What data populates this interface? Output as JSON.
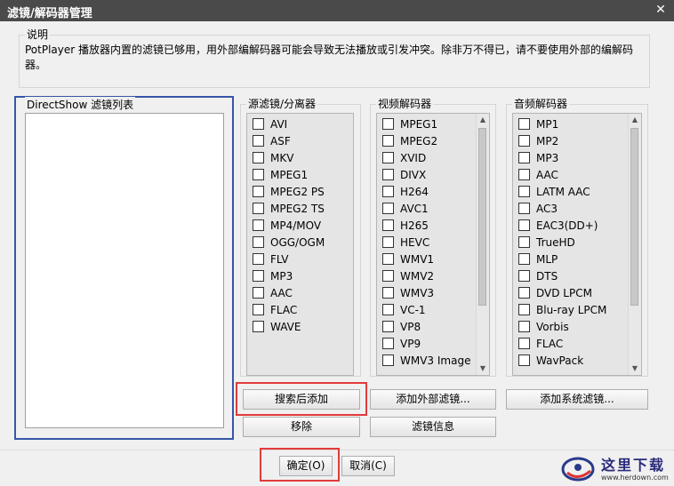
{
  "window": {
    "title": "滤镜/解码器管理",
    "close_glyph": "✕"
  },
  "description": {
    "label": "说明",
    "text": "PotPlayer 播放器内置的滤镜已够用，用外部编解码器可能会导致无法播放或引发冲突。除非万不得已，请不要使用外部的编解码器。"
  },
  "directshow": {
    "label": "DirectShow 滤镜列表"
  },
  "source_filters": {
    "label": "源滤镜/分离器",
    "items": [
      "AVI",
      "ASF",
      "MKV",
      "MPEG1",
      "MPEG2 PS",
      "MPEG2 TS",
      "MP4/MOV",
      "OGG/OGM",
      "FLV",
      "MP3",
      "AAC",
      "FLAC",
      "WAVE"
    ]
  },
  "video_decoders": {
    "label": "视频解码器",
    "items": [
      "MPEG1",
      "MPEG2",
      "XVID",
      "DIVX",
      "H264",
      "AVC1",
      "H265",
      "HEVC",
      "WMV1",
      "WMV2",
      "WMV3",
      "VC-1",
      "VP8",
      "VP9",
      "WMV3 Image"
    ]
  },
  "audio_decoders": {
    "label": "音频解码器",
    "items": [
      "MP1",
      "MP2",
      "MP3",
      "AAC",
      "LATM AAC",
      "AC3",
      "EAC3(DD+)",
      "TrueHD",
      "MLP",
      "DTS",
      "DVD LPCM",
      "Blu-ray LPCM",
      "Vorbis",
      "FLAC",
      "WavPack"
    ]
  },
  "buttons": {
    "search_add": "搜索后添加",
    "remove": "移除",
    "add_external": "添加外部滤镜...",
    "filter_info": "滤镜信息",
    "add_system": "添加系统滤镜...",
    "ok": "确定(O)",
    "cancel": "取消(C)"
  },
  "watermark": {
    "text": "这里下载",
    "url": "www.herdown.com"
  },
  "colors": {
    "highlight_red": "#e23b3b",
    "highlight_blue": "#3656a9",
    "titlebar": "#4a4a4a"
  }
}
